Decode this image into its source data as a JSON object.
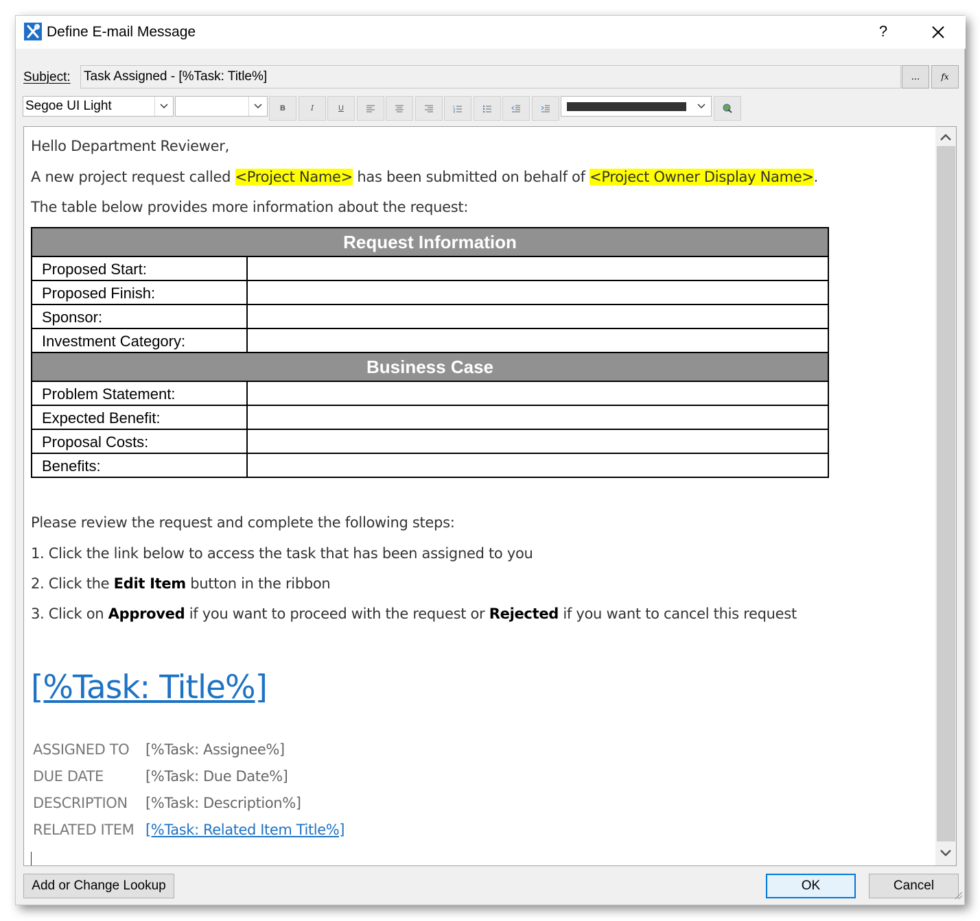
{
  "window": {
    "title": "Define E-mail Message",
    "help_label": "?"
  },
  "subject": {
    "label": "Subject:",
    "value": "Task Assigned - [%Task: Title%]",
    "browse_label": "...",
    "function_label": "fx"
  },
  "toolbar": {
    "font_name": "Segoe UI Light",
    "font_size": "",
    "bold_label": "B",
    "italic_label": "I",
    "underline_label": "U",
    "text_color": "#333333"
  },
  "body": {
    "greeting": "Hello Department Reviewer,",
    "intro_part1": "A new project request called ",
    "project_name_token": "<Project Name>",
    "intro_part2": " has been submitted on behalf of ",
    "owner_token": "<Project Owner Display Name>",
    "intro_part3": ".",
    "table_intro": "The table below provides more information about the request:",
    "table": {
      "section1_title": "Request Information",
      "section1_rows": [
        "Proposed Start:",
        "Proposed Finish:",
        "Sponsor:",
        "Investment Category:"
      ],
      "section2_title": "Business Case",
      "section2_rows": [
        "Problem Statement:",
        "Expected Benefit:",
        "Proposal Costs:",
        "Benefits:"
      ]
    },
    "steps_intro": "Please review the request and complete the following steps:",
    "step1": "1. Click the link below to access the task that has been assigned to you",
    "step2_a": "2. Click the ",
    "step2_b": "Edit Item",
    "step2_c": " button in the ribbon",
    "step3_a": "3. Click on ",
    "step3_b": "Approved",
    "step3_c": " if you want to proceed with the request or ",
    "step3_d": "Rejected",
    "step3_e": " if you want to cancel this request",
    "task_link": "[%Task: Title%]",
    "meta": {
      "assigned_label": "ASSIGNED TO",
      "assigned_value": "[%Task: Assignee%]",
      "due_label": "DUE DATE",
      "due_value": "[%Task: Due Date%]",
      "description_label": "DESCRIPTION",
      "description_value": "[%Task: Description%]",
      "related_label": "RELATED ITEM",
      "related_value": "[%Task: Related Item Title%]"
    }
  },
  "footer": {
    "lookup_label": "Add or Change Lookup",
    "ok_label": "OK",
    "cancel_label": "Cancel"
  },
  "colors": {
    "highlight": "#ffff00",
    "link": "#1e72c4",
    "table_header": "#919191",
    "ok_border": "#0078d7"
  }
}
